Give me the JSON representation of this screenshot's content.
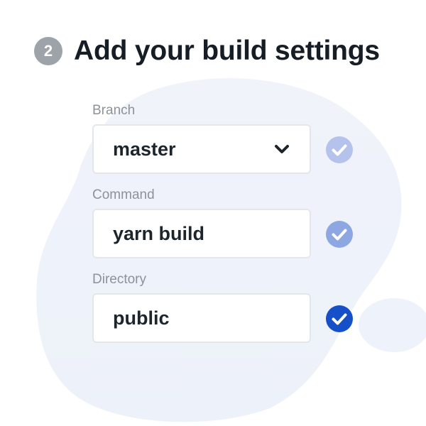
{
  "step": {
    "number": "2",
    "title": "Add your build settings"
  },
  "fields": [
    {
      "label": "Branch",
      "value": "master",
      "control": "select",
      "status": "complete-faded"
    },
    {
      "label": "Command",
      "value": "yarn build",
      "control": "text",
      "status": "complete-muted"
    },
    {
      "label": "Directory",
      "value": "public",
      "control": "text",
      "status": "complete-active"
    }
  ],
  "icons": {
    "dropdown": "chevron-down-icon",
    "status": "check-circle-icon"
  },
  "colors": {
    "title": "#161d24",
    "badge": "#9da3a8",
    "label": "#8d9299",
    "value": "#1d252c",
    "field_border": "#e4e7ea",
    "check_faded": "#b5c3ec",
    "check_muted": "#8da7e2",
    "check_active": "#1650c8",
    "background_blob": "#eef2fa"
  }
}
